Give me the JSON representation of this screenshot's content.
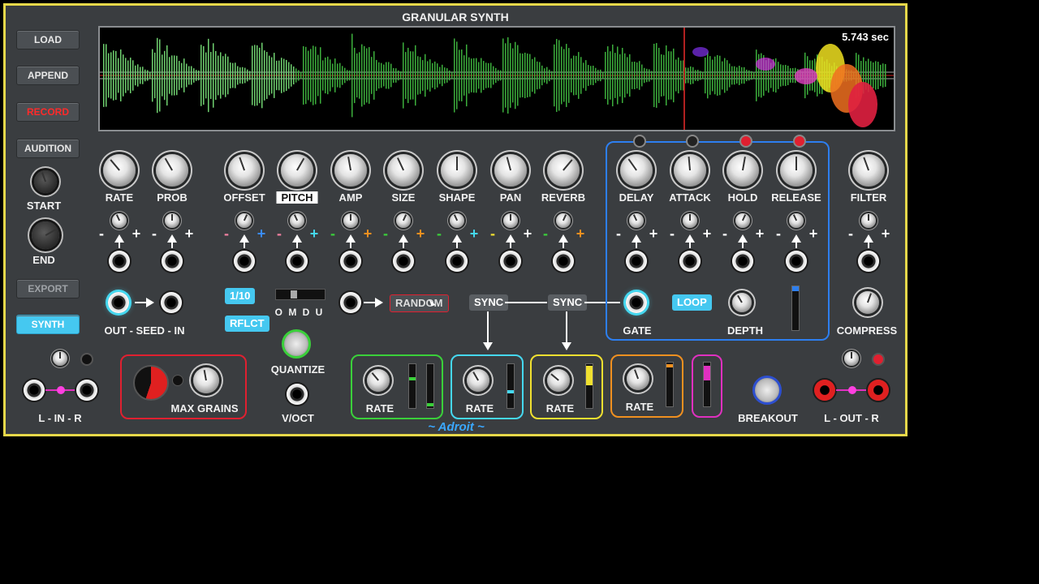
{
  "app_title": "GRANULAR SYNTH",
  "waveform": {
    "duration_label": "5.743 sec"
  },
  "left_buttons": {
    "load": "LOAD",
    "append": "APPEND",
    "record": "RECORD",
    "audition": "AUDITION",
    "export": "EXPORT",
    "synth": "SYNTH"
  },
  "left_labels": {
    "start": "START",
    "end": "END",
    "out_seed_in": "OUT - SEED - IN",
    "l_in_r": "L - IN - R"
  },
  "grain_params": {
    "rate": "RATE",
    "prob": "PROB",
    "offset": "OFFSET",
    "pitch": "PITCH",
    "amp": "AMP",
    "size": "SIZE",
    "shape": "SHAPE",
    "pan": "PAN",
    "reverb": "REVERB"
  },
  "envelope": {
    "delay": "DELAY",
    "attack": "ATTACK",
    "hold": "HOLD",
    "release": "RELEASE",
    "gate": "GATE",
    "loop": "LOOP",
    "depth": "DEPTH"
  },
  "right_params": {
    "filter": "FILTER",
    "compress": "COMPRESS",
    "l_out_r": "L - OUT - R"
  },
  "middle": {
    "ratio": "1/10",
    "reflect": "RFLCT",
    "modes": "O M D U",
    "quantize": "QUANTIZE",
    "voct": "V/OCT",
    "random": "RANDOM",
    "sync1": "SYNC",
    "sync2": "SYNC",
    "max_grains": "MAX GRAINS"
  },
  "lfo_labels": {
    "lfo1": "RATE",
    "lfo2": "RATE",
    "lfo3": "RATE",
    "lfo4": "RATE"
  },
  "breakout": "BREAKOUT",
  "brand": "~ Adroit ~",
  "plus_minus": {
    "minus": "-",
    "plus": "+"
  },
  "colors": {
    "panel_border": "#e7d84a",
    "envelope_border": "#2d7ff0",
    "max_grains_border": "#e02030",
    "lfo_green": "#3ad03a",
    "lfo_cyan": "#45d8f0",
    "lfo_yellow": "#f0e030",
    "lfo_orange": "#f09020",
    "lfo_magenta": "#e030c0",
    "record": "#ff2a2a",
    "synth_on": "#45c8f0"
  }
}
